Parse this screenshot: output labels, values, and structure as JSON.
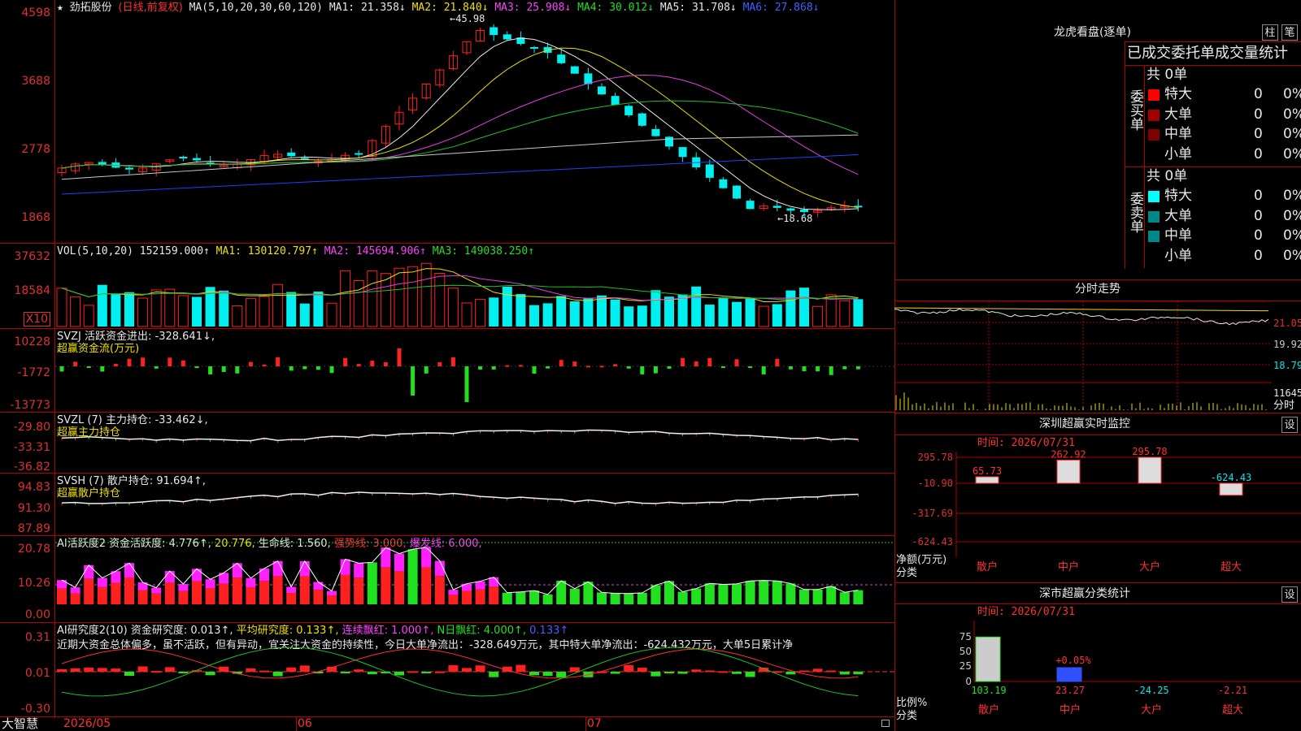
{
  "colors": {
    "up": "#ff2020",
    "down": "#00f0f0",
    "grid": "#b00000",
    "ma1": "#e8e8e8",
    "ma2": "#e8e000",
    "ma3": "#e040e0",
    "ma4": "#20c020",
    "ma5": "#c8c8c8",
    "ma6": "#2040ff"
  },
  "header": {
    "star": "★",
    "stock_name": "劲拓股份",
    "period": "(日线,前复权)",
    "ma_params": "MA(5,10,20,30,60,120)",
    "ma1": "MA1: 21.358↓",
    "ma2": "MA2: 21.840↓",
    "ma3": "MA3: 25.908↓",
    "ma4": "MA4: 30.012↓",
    "ma5": "MA5: 31.708↓",
    "ma6": "MA6: 27.868↓",
    "high_label": "←45.98",
    "low_label": "←18.68"
  },
  "price_axis": [
    "4598",
    "3688",
    "2778",
    "1868"
  ],
  "vol": {
    "title": "VOL(5,10,20)",
    "value": "152159.000↑",
    "ma1": "MA1: 130120.797↑",
    "ma2": "MA2: 145694.906↑",
    "ma3": "MA3: 149038.250↑",
    "axis": [
      "37632",
      "18584"
    ],
    "unit": "X10"
  },
  "svzj": {
    "title": "SVZJ  活跃资金进出: -328.641↓,",
    "subtitle": "超赢资金流(万元)",
    "axis": [
      "10228",
      "-1772",
      "-13773"
    ]
  },
  "svzl": {
    "title": "SVZL (7) 主力持仓: -33.462↓,",
    "subtitle": "超赢主力持仓",
    "axis": [
      "-29.80",
      "-33.31",
      "-36.82"
    ]
  },
  "svsh": {
    "title": "SVSH (7) 散户持仓: 91.694↑,",
    "subtitle": "超赢散户持仓",
    "axis": [
      "94.83",
      "91.30",
      "87.89"
    ]
  },
  "ai1": {
    "title": "AI活跃度2 资金活跃度: 4.776↑,",
    "v2": "20.776,",
    "v3": "生命线: 1.560,",
    "v4": "强势线: 3.000,",
    "v5": "爆发线: 6.000,",
    "axis": [
      "20.78",
      "10.26",
      "0.00"
    ]
  },
  "ai2": {
    "title": "AI研究度2(10) 资金研究度: 0.013↑,",
    "v2": "平均研究度: 0.133↑,",
    "v3": "连续飘红: 1.000↑,",
    "v4": "N日飘红: 4.000↑,",
    "v5": "0.133↑",
    "comment": "近期大资金总体偏多，虽不活跃，但有异动，宜关注大资金的持续性，今日大单净流出：-328.649万元，其中特大单净流出：-624.432万元，大单5日累计净",
    "axis": [
      "0.31",
      "0.01",
      "-0.30"
    ]
  },
  "xaxis": {
    "logo": "大智慧",
    "labels": [
      "2026/05",
      "06",
      "07"
    ]
  },
  "right": {
    "lhb_title": "龙虎看盘(逐单)",
    "btn_zhu": "柱",
    "btn_bi": "笔",
    "stat_title": "已成交委托单成交量统计",
    "buy_label": "委买单",
    "sell_label": "委卖单",
    "buy_total": "共 0单",
    "sell_total": "共 0单",
    "rows": [
      {
        "name": "特大",
        "v": "0",
        "p": "0%"
      },
      {
        "name": "大单",
        "v": "0",
        "p": "0%"
      },
      {
        "name": "中单",
        "v": "0",
        "p": "0%"
      },
      {
        "name": "小单",
        "v": "0",
        "p": "0%"
      }
    ],
    "buy_colors": [
      "#ff0000",
      "#a00000",
      "#800000",
      "#000000"
    ],
    "sell_colors": [
      "#00ffff",
      "#008888",
      "#008888",
      "#000000"
    ],
    "fs_title": "分时走势",
    "fs_axis": [
      "21.05",
      "19.92",
      "18.79",
      "11645"
    ],
    "fs_unit": "分时",
    "sz_title": "深圳超赢实时监控",
    "sz_btn": "设",
    "sz_time": "时间: 2026/07/31",
    "sz_axis": [
      "295.78",
      "-10.90",
      "-317.69",
      "-624.43"
    ],
    "sz_unit1": "净额(万元)",
    "sz_unit2": "分类",
    "sz_cats": [
      "散户",
      "中户",
      "大户",
      "超大"
    ],
    "sz_vals": [
      65.73,
      262.92,
      295.78,
      -624.43
    ],
    "sz_labels": [
      "65.73",
      "262.92",
      "295.78",
      "-624.43"
    ],
    "fl_title": "深市超赢分类统计",
    "fl_btn": "设",
    "fl_time": "时间: 2026/07/31",
    "fl_axis": [
      "75",
      "50",
      "25",
      "0"
    ],
    "fl_unit1": "比例%",
    "fl_unit2": "分类",
    "fl_cats": [
      "散户",
      "中户",
      "大户",
      "超大"
    ],
    "fl_vals": [
      103.19,
      23.27,
      -24.25,
      -2.21
    ],
    "fl_labels": [
      "103.19",
      "23.27",
      "-24.25",
      "-2.21"
    ],
    "fl_top": "+0.05%"
  }
}
